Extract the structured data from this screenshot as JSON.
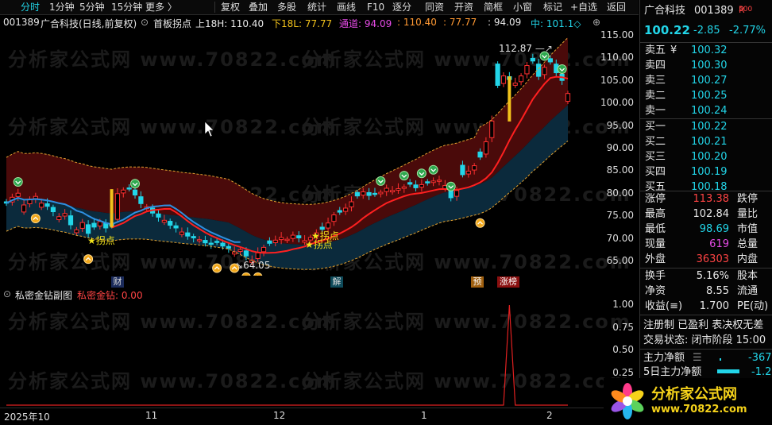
{
  "toolbar": {
    "left_items": [
      "分时",
      "1分钟",
      "5分钟",
      "15分钟",
      "更多 〉"
    ],
    "right_items": [
      "复权",
      "叠加",
      "多股",
      "统计",
      "画线",
      "F10",
      "逐分",
      "同资",
      "开资",
      "简框",
      "小窗",
      "标记",
      "+自选",
      "返回"
    ]
  },
  "info": {
    "code": "001389",
    "name": "广合科技",
    "mode": "(日线,前复权)",
    "indicator": "首板拐点",
    "upper_label": "上18H: 110.40",
    "lower_label": "下18L: 77.77",
    "channel_label": "通道: 94.09",
    "v1": ": 110.40",
    "v2": ": 77.77",
    "v3": ": 94.09",
    "mid_label": "中: 101.1◇"
  },
  "main_axis": {
    "ticks": [
      "115.00",
      "110.00",
      "105.00",
      "100.00",
      "95.00",
      "90.00",
      "85.00",
      "80.00",
      "75.00",
      "70.00",
      "65.00"
    ]
  },
  "chart_data": {
    "type": "candlestick",
    "ylim": [
      62,
      117
    ],
    "high_marker": "112.87",
    "low_marker": "64.05",
    "signal_labels": [
      "拐点",
      "拐点",
      "拐点"
    ],
    "event_labels": [
      "财",
      "解",
      "预",
      "涨榜"
    ],
    "closes": [
      77.9,
      79.2,
      80.1,
      77.5,
      78.8,
      79.4,
      77.9,
      77.2,
      76.0,
      74.9,
      75.6,
      73.1,
      72.0,
      73.6,
      71.2,
      72.6,
      73.8,
      72.4,
      72.9,
      80.0,
      80.8,
      81.1,
      79.7,
      77.8,
      77.1,
      75.7,
      74.8,
      74.1,
      73.0,
      72.4,
      71.5,
      70.6,
      70.2,
      69.8,
      69.1,
      68.8,
      69.2,
      68.4,
      67.9,
      67.1,
      67.6,
      66.2,
      65.3,
      66.9,
      68.1,
      69.0,
      69.7,
      70.3,
      69.9,
      70.8,
      70.2,
      69.6,
      70.3,
      71.3,
      72.1,
      73.5,
      75.3,
      75.9,
      76.8,
      78.2,
      79.5,
      80.4,
      79.6,
      79.9,
      80.3,
      81.2,
      80.7,
      81.1,
      81.5,
      82.1,
      81.3,
      82.0,
      82.4,
      82.8,
      83.0,
      81.8,
      79.1,
      80.7,
      84.2,
      85.0,
      86.2,
      88.1,
      91.5,
      96.1,
      104.0,
      106.1,
      105.3,
      104.5,
      106.1,
      108.4,
      109.4,
      106.0,
      108.0,
      109.2,
      106.8,
      105.1,
      102.2
    ],
    "subchart": {
      "title": "私密金钻副图",
      "series_label": "私密金钻: 0.00",
      "ylim": [
        0,
        1.1
      ],
      "ticks": [
        "1.00",
        "0.75",
        "0.50",
        "0.25"
      ],
      "spike_at_index": 86,
      "spike_value": 1.0
    },
    "x_ticks": [
      "2025年10",
      "11",
      "12",
      "1",
      "2"
    ]
  },
  "panel": {
    "name": "广合科技",
    "code": "001389",
    "badge": "R",
    "badge_sub": "500",
    "price": "100.22",
    "change": "-2.85",
    "change_pct": "-2.77%",
    "asks": [
      {
        "label": "卖五",
        "mark": "¥",
        "price": "100.32"
      },
      {
        "label": "卖四",
        "mark": "",
        "price": "100.30"
      },
      {
        "label": "卖三",
        "mark": "",
        "price": "100.27"
      },
      {
        "label": "卖二",
        "mark": "",
        "price": "100.25"
      },
      {
        "label": "卖一",
        "mark": "",
        "price": "100.24"
      }
    ],
    "bids": [
      {
        "label": "买一",
        "price": "100.22"
      },
      {
        "label": "买二",
        "price": "100.21"
      },
      {
        "label": "买三",
        "price": "100.20"
      },
      {
        "label": "买四",
        "price": "100.19"
      },
      {
        "label": "买五",
        "price": "100.18"
      }
    ],
    "stats": [
      {
        "label": "涨停",
        "value": "113.38",
        "label2": "跌停"
      },
      {
        "label": "最高",
        "value": "102.84",
        "label2": "量比"
      },
      {
        "label": "最低",
        "value": "98.69",
        "label2": "市值"
      },
      {
        "label": "现量",
        "value": "619",
        "label2": "总量"
      },
      {
        "label": "外盘",
        "value": "36303",
        "label2": "内盘"
      }
    ],
    "stats2": [
      {
        "label": "换手",
        "value": "5.16%",
        "label2": "股本"
      },
      {
        "label": "净资",
        "value": "8.55",
        "label2": "流通"
      },
      {
        "label": "收益(≡)",
        "value": "1.700",
        "label2": "PE(动)"
      }
    ],
    "reg_line": "注册制 已盈利 表决权无差",
    "trade_state": "交易状态: 闭市阶段 15:00",
    "flow1_label": "主力净额",
    "flow1_value": "-367",
    "flow2_label": "5日主力净额",
    "flow2_value": "-1.2"
  },
  "logo": {
    "title": "分析家公式网",
    "url": "www.70822.com"
  },
  "watermark": "分析家公式网 www.70822.com",
  "colors": {
    "up": "#ff3030",
    "down": "#22d5e8",
    "upper_band": "#4a0a0a",
    "lower_band": "#0b2a3c",
    "ma": "#ff2020",
    "ma2": "#2e8fe0"
  }
}
